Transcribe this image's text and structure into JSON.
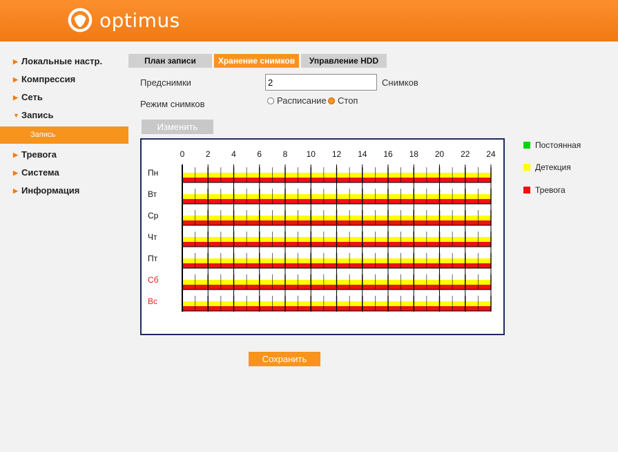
{
  "brand": {
    "name": "optimus",
    "logo_icon": "optimus-ring-logo"
  },
  "colors": {
    "accent": "#f7941d",
    "continuous": "#00d400",
    "motion": "#ffff00",
    "alarm": "#ee1111",
    "weekend": "#e02020"
  },
  "sidebar": {
    "items": [
      {
        "label": "Локальные настр.",
        "expanded": false
      },
      {
        "label": "Компрессия",
        "expanded": false
      },
      {
        "label": "Сеть",
        "expanded": false
      },
      {
        "label": "Запись",
        "expanded": true
      },
      {
        "label": "Тревога",
        "expanded": false
      },
      {
        "label": "Система",
        "expanded": false
      },
      {
        "label": "Информация",
        "expanded": false
      }
    ],
    "sub_item": "Запись"
  },
  "tabs": [
    {
      "label": "План записи",
      "active": false
    },
    {
      "label": "Хранение снимков",
      "active": true
    },
    {
      "label": "Управление HDD",
      "active": false
    }
  ],
  "form": {
    "presnapshots_label": "Предснимки",
    "presnapshots_value": "2",
    "presnapshots_unit": "Снимков",
    "mode_label": "Режим снимков",
    "mode_option_schedule": "Расписание",
    "mode_option_stop": "Стоп",
    "mode_selected": "Стоп",
    "edit_button": "Изменить",
    "save_button": "Сохранить"
  },
  "schedule": {
    "hour_ticks": [
      "0",
      "2",
      "4",
      "6",
      "8",
      "10",
      "12",
      "14",
      "16",
      "18",
      "20",
      "22",
      "24"
    ],
    "days": [
      {
        "label": "Пн",
        "weekend": false
      },
      {
        "label": "Вт",
        "weekend": false
      },
      {
        "label": "Ср",
        "weekend": false
      },
      {
        "label": "Чт",
        "weekend": false
      },
      {
        "label": "Пт",
        "weekend": false
      },
      {
        "label": "Сб",
        "weekend": true
      },
      {
        "label": "Вс",
        "weekend": true
      }
    ],
    "every_hour": [
      "motion",
      "alarm"
    ]
  },
  "legend": [
    {
      "label": "Постоянная",
      "type": "continuous"
    },
    {
      "label": "Детекция",
      "type": "motion"
    },
    {
      "label": "Тревога",
      "type": "alarm"
    }
  ]
}
